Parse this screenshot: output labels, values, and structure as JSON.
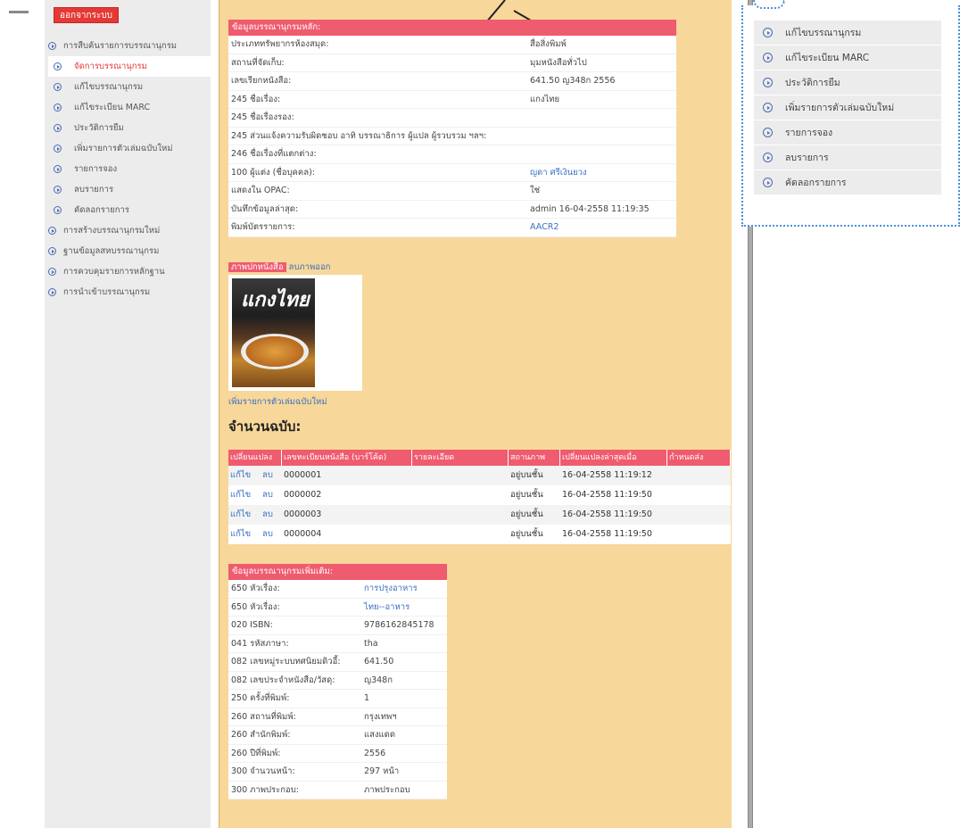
{
  "logout_label": "ออกจากระบบ",
  "sidebar": {
    "items": [
      {
        "label": "การสืบค้นรายการบรรณานุกรม",
        "active": false,
        "sub": false
      },
      {
        "label": "จัดการบรรณานุกรม",
        "active": true,
        "sub": true
      },
      {
        "label": "แก้ไขบรรณานุกรม",
        "active": false,
        "sub": true
      },
      {
        "label": "แก้ไขระเบียน MARC",
        "active": false,
        "sub": true
      },
      {
        "label": "ประวัติการยืม",
        "active": false,
        "sub": true
      },
      {
        "label": "เพิ่มรายการตัวเล่มฉบับใหม่",
        "active": false,
        "sub": true
      },
      {
        "label": "รายการจอง",
        "active": false,
        "sub": true
      },
      {
        "label": "ลบรายการ",
        "active": false,
        "sub": true
      },
      {
        "label": "คัดลอกรายการ",
        "active": false,
        "sub": true
      },
      {
        "label": "การสร้างบรรณานุกรมใหม่",
        "active": false,
        "sub": false
      },
      {
        "label": "ฐานข้อมูลสหบรรณานุกรม",
        "active": false,
        "sub": false
      },
      {
        "label": "การควบคุมรายการหลักฐาน",
        "active": false,
        "sub": false
      },
      {
        "label": "การนำเข้าบรรณานุกรม",
        "active": false,
        "sub": false
      }
    ]
  },
  "main_panel": {
    "header": "ข้อมูลบรรณานุกรมหลัก:",
    "rows": [
      {
        "k": "ประเภททรัพยากรห้องสมุด:",
        "v": "สื่อสิ่งพิมพ์",
        "link": false
      },
      {
        "k": "สถานที่จัดเก็บ:",
        "v": "มุมหนังสือทั่วไป",
        "link": false
      },
      {
        "k": "เลขเรียกหนังสือ:",
        "v": "641.50 ญ348ก 2556",
        "link": false
      },
      {
        "k": "245 ชื่อเรื่อง:",
        "v": "แกงไทย",
        "link": false
      },
      {
        "k": "245 ชื่อเรื่องรอง:",
        "v": "",
        "link": false
      },
      {
        "k": "245 ส่วนแจ้งความรับผิดชอบ อาทิ บรรณาธิการ ผู้แปล ผู้รวบรวม ฯลฯ:",
        "v": "",
        "link": false
      },
      {
        "k": "246 ชื่อเรื่องที่แตกต่าง:",
        "v": "",
        "link": false
      },
      {
        "k": "100 ผู้แต่ง (ชื่อบุคคล):",
        "v": "ญดา ศรีเงินยวง",
        "link": true
      },
      {
        "k": "แสดงใน OPAC:",
        "v": "ใช่",
        "link": false
      },
      {
        "k": "บันทึกข้อมูลล่าสุด:",
        "v": "admin 16-04-2558 11:19:35",
        "link": false
      },
      {
        "k": "พิมพ์บัตรรายการ:",
        "v": "AACR2",
        "link": true
      }
    ]
  },
  "cover": {
    "tab_active": "ภาพปกหนังสือ",
    "tab_delete": "ลบภาพออก",
    "title_text": "แกงไทย",
    "add_copy_link": "เพิ่มรายการตัวเล่มฉบับใหม่"
  },
  "copies": {
    "title": "จำนวนฉบับ:",
    "headers": [
      "เปลี่ยนแปลง",
      "เลขทะเบียนหนังสือ (บาร์โค้ด)",
      "รายละเอียด",
      "สถานภาพ",
      "เปลี่ยนแปลงล่าสุดเมื่อ",
      "กำหนดส่ง"
    ],
    "edit_label": "แก้ไข",
    "delete_label": "ลบ",
    "rows": [
      {
        "barcode": "0000001",
        "detail": "",
        "status": "อยู่บนชั้น",
        "updated": "16-04-2558 11:19:12",
        "due": ""
      },
      {
        "barcode": "0000002",
        "detail": "",
        "status": "อยู่บนชั้น",
        "updated": "16-04-2558 11:19:50",
        "due": ""
      },
      {
        "barcode": "0000003",
        "detail": "",
        "status": "อยู่บนชั้น",
        "updated": "16-04-2558 11:19:50",
        "due": ""
      },
      {
        "barcode": "0000004",
        "detail": "",
        "status": "อยู่บนชั้น",
        "updated": "16-04-2558 11:19:50",
        "due": ""
      }
    ]
  },
  "extra_panel": {
    "header": "ข้อมูลบรรณานุกรมเพิ่มเติม:",
    "rows": [
      {
        "k": "650 หัวเรื่อง:",
        "v": "การปรุงอาหาร",
        "link": true
      },
      {
        "k": "650 หัวเรื่อง:",
        "v": "ไทย--อาหาร",
        "link": true
      },
      {
        "k": "020 ISBN:",
        "v": "9786162845178",
        "link": false
      },
      {
        "k": "041 รหัสภาษา:",
        "v": "tha",
        "link": false
      },
      {
        "k": "082 เลขหมู่ระบบทศนิยมดิวอี้:",
        "v": "641.50",
        "link": false
      },
      {
        "k": "082 เลขประจำหนังสือ/วัสดุ:",
        "v": "ญ348ก",
        "link": false
      },
      {
        "k": "250 ครั้งที่พิมพ์:",
        "v": "1",
        "link": false
      },
      {
        "k": "260 สถานที่พิมพ์:",
        "v": "กรุงเทพฯ",
        "link": false
      },
      {
        "k": "260 สำนักพิมพ์:",
        "v": "แสงแดด",
        "link": false
      },
      {
        "k": "260 ปีที่พิมพ์:",
        "v": "2556",
        "link": false
      },
      {
        "k": "300 จำนวนหน้า:",
        "v": "297 หน้า",
        "link": false
      },
      {
        "k": "300 ภาพประกอบ:",
        "v": "ภาพประกอบ",
        "link": false
      }
    ]
  },
  "popup_menu": {
    "items": [
      "แก้ไขบรรณานุกรม",
      "แก้ไขระเบียน MARC",
      "ประวัติการยืม",
      "เพิ่มรายการตัวเล่มฉบับใหม่",
      "รายการจอง",
      "ลบรายการ",
      "คัดลอกรายการ"
    ]
  },
  "colors": {
    "header_pink": "#ef5b6f",
    "logout_red": "#e53935",
    "link_blue": "#3a6fc4",
    "main_bg": "#f7d79a",
    "popup_border": "#4a90d9"
  }
}
